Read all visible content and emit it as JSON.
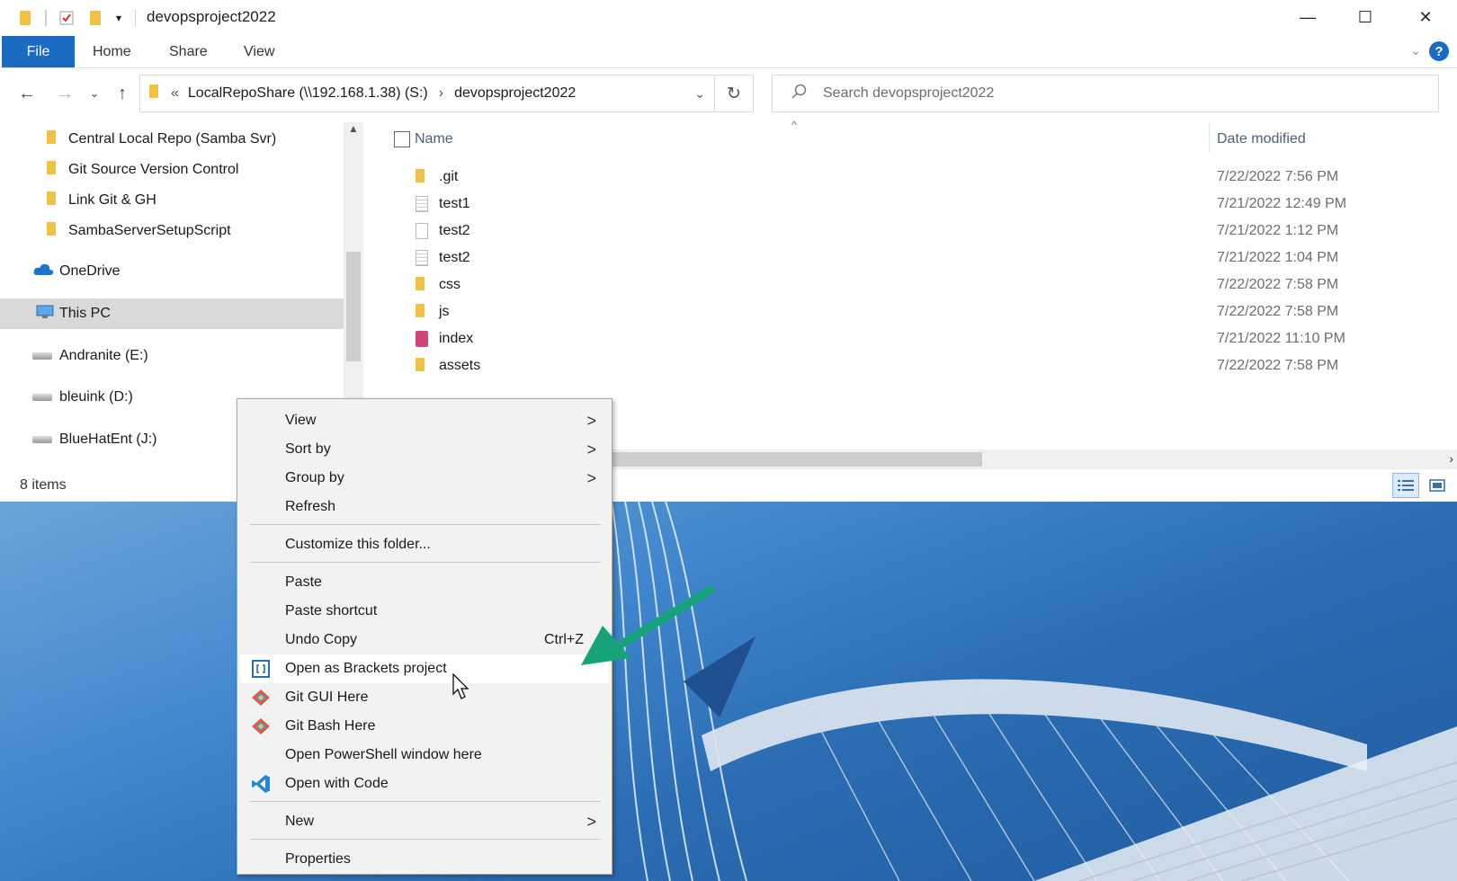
{
  "window": {
    "title": "devopsproject2022",
    "controls": [
      "minimize",
      "maximize",
      "close"
    ]
  },
  "ribbon": {
    "tabs": [
      "File",
      "Home",
      "Share",
      "View"
    ],
    "help": "?"
  },
  "address": {
    "overflow": "«",
    "crumbs": [
      "LocalRepoShare (\\\\192.168.1.38) (S:)",
      "devopsproject2022"
    ],
    "separator": "›"
  },
  "search": {
    "placeholder": "Search devopsproject2022"
  },
  "nav": {
    "items": [
      {
        "label": "Central Local Repo (Samba Svr)",
        "icon": "folder-icon"
      },
      {
        "label": "Git Source Version Control",
        "icon": "folder-icon"
      },
      {
        "label": "Link Git & GH",
        "icon": "folder-icon"
      },
      {
        "label": "SambaServerSetupScript",
        "icon": "folder-icon"
      },
      {
        "label": "OneDrive",
        "icon": "cloud-icon"
      },
      {
        "label": "This PC",
        "icon": "pc-icon"
      },
      {
        "label": "Andranite (E:)",
        "icon": "drive-icon"
      },
      {
        "label": "bleuink (D:)",
        "icon": "drive-icon"
      },
      {
        "label": "BlueHatEnt (J:)",
        "icon": "drive-icon"
      }
    ]
  },
  "columns": {
    "name": "Name",
    "date": "Date modified"
  },
  "files": [
    {
      "name": ".git",
      "date": "7/22/2022 7:56 PM",
      "icon": "folder-icon"
    },
    {
      "name": "test1",
      "date": "7/21/2022 12:49 PM",
      "icon": "text-file-icon"
    },
    {
      "name": "test2",
      "date": "7/21/2022 1:12 PM",
      "icon": "blank-file-icon"
    },
    {
      "name": "test2",
      "date": "7/21/2022 1:04 PM",
      "icon": "text-file-icon"
    },
    {
      "name": "css",
      "date": "7/22/2022 7:58 PM",
      "icon": "folder-icon"
    },
    {
      "name": "js",
      "date": "7/22/2022 7:58 PM",
      "icon": "folder-icon"
    },
    {
      "name": "index",
      "date": "7/21/2022 11:10 PM",
      "icon": "html-file-icon"
    },
    {
      "name": "assets",
      "date": "7/22/2022 7:58 PM",
      "icon": "folder-icon"
    }
  ],
  "status": {
    "count": "8 items"
  },
  "context_menu": {
    "items": [
      {
        "label": "View",
        "submenu": ">"
      },
      {
        "label": "Sort by",
        "submenu": ">"
      },
      {
        "label": "Group by",
        "submenu": ">"
      },
      {
        "label": "Refresh"
      },
      {
        "label": "Customize this folder..."
      },
      {
        "label": "Paste"
      },
      {
        "label": "Paste shortcut"
      },
      {
        "label": "Undo Copy",
        "shortcut": "Ctrl+Z"
      },
      {
        "label": "Open as Brackets project",
        "icon": "brackets-icon"
      },
      {
        "label": "Git GUI Here",
        "icon": "git-icon"
      },
      {
        "label": "Git Bash Here",
        "icon": "git-icon"
      },
      {
        "label": "Open PowerShell window here"
      },
      {
        "label": "Open with Code",
        "icon": "vscode-icon"
      },
      {
        "label": "New",
        "submenu": ">"
      },
      {
        "label": "Properties"
      }
    ]
  },
  "colors": {
    "accent": "#1a6bc1",
    "annotation_arrow": "#17a37a"
  }
}
